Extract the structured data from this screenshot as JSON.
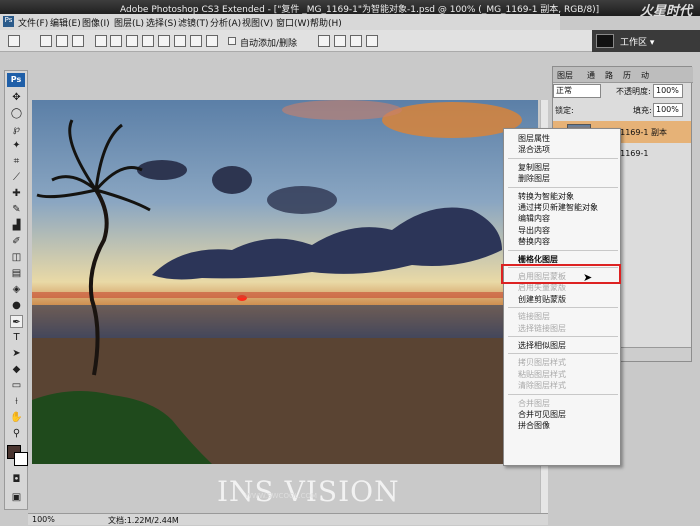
{
  "window": {
    "title": "Adobe Photoshop CS3 Extended - [\"复件 _MG_1169-1\"为智能对象-1.psd @ 100% (_MG_1169-1 副本, RGB/8)]",
    "logo": "火星时代"
  },
  "menus": [
    "文件(F)",
    "编辑(E)",
    "图像(I)",
    "图层(L)",
    "选择(S)",
    "滤镜(T)",
    "分析(A)",
    "视图(V)",
    "窗口(W)",
    "帮助(H)"
  ],
  "options_bar": {
    "auto_add_delete": "自动添加/删除"
  },
  "workspace_label": "工作区 ▾",
  "toolbox_logo": "Ps",
  "canvas": {
    "watermark": "INS VISION",
    "watermark_sub": "WWW.SWCOOL.COM"
  },
  "status": {
    "zoom": "100%",
    "doc": "文档:1.22M/2.44M"
  },
  "layers_panel": {
    "tabs": [
      "图层",
      "通",
      "路",
      "历",
      "动"
    ],
    "blend_mode": "正常",
    "opacity_label": "不透明度:",
    "opacity": "100%",
    "lock_label": "锁定:",
    "fill_label": "填充:",
    "fill": "100%",
    "layers": [
      {
        "name": "_MG_1169-1 副本",
        "selected": true
      },
      {
        "name": "_MG_1169-1",
        "selected": false
      }
    ]
  },
  "context_menu": {
    "groups": [
      [
        {
          "label": "图层属性",
          "enabled": true
        },
        {
          "label": "混合选项",
          "enabled": true
        }
      ],
      [
        {
          "label": "复制图层",
          "enabled": true
        },
        {
          "label": "删除图层",
          "enabled": true
        }
      ],
      [
        {
          "label": "转换为智能对象",
          "enabled": true
        },
        {
          "label": "通过拷贝新建智能对象",
          "enabled": true
        },
        {
          "label": "编辑内容",
          "enabled": true
        },
        {
          "label": "导出内容",
          "enabled": true
        },
        {
          "label": "替换内容",
          "enabled": true
        }
      ],
      [
        {
          "label": "栅格化图层",
          "enabled": true,
          "highlighted": true
        }
      ],
      [
        {
          "label": "启用图层蒙板",
          "enabled": false
        },
        {
          "label": "启用矢量蒙版",
          "enabled": false
        },
        {
          "label": "创建剪贴蒙版",
          "enabled": true
        }
      ],
      [
        {
          "label": "链接图层",
          "enabled": false
        },
        {
          "label": "选择链接图层",
          "enabled": false
        }
      ],
      [
        {
          "label": "选择相似图层",
          "enabled": true
        }
      ],
      [
        {
          "label": "拷贝图层样式",
          "enabled": false
        },
        {
          "label": "粘贴图层样式",
          "enabled": false
        },
        {
          "label": "清除图层样式",
          "enabled": false
        }
      ],
      [
        {
          "label": "合并图层",
          "enabled": false
        },
        {
          "label": "合并可见图层",
          "enabled": true
        },
        {
          "label": "拼合图像",
          "enabled": true
        }
      ]
    ]
  },
  "colors": {
    "highlight": "#ebc182",
    "highlight_border": "#d22222",
    "selected_layer": "#e6b277"
  }
}
